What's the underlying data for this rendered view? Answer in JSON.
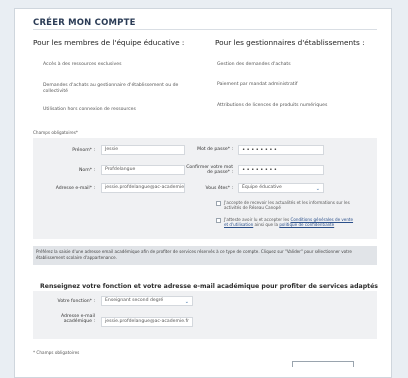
{
  "page": {
    "title": "CRÉER MON COMPTE",
    "col_left_heading": "Pour les membres de l'équipe éducative :",
    "col_right_heading": "Pour les gestionnaires d'établissements :",
    "left_features": [
      "Accès à des ressources exclusives",
      "Demandes d'achats au gestionnaire d'établissement ou de collectivité",
      "Utilisation hors connexion de ressources"
    ],
    "right_features": [
      "Gestion des demandes d'achats",
      "Paiement par mandat administratif",
      "Attributions de licences de produits numériques"
    ],
    "required_note": "Champs obligatoires*"
  },
  "form": {
    "prenom_label": "Prénom* :",
    "prenom_value": "Jessie",
    "nom_label": "Nom* :",
    "nom_value": "Profdelangue",
    "email_label": "Adresse e-mail* :",
    "email_value": "jessie.profdelangue@ac-academie.fr",
    "password_label": "Mot de passe* :",
    "password_value": "••••••••",
    "confirm_label": "Confirmer votre mot de passe* :",
    "confirm_value": "••••••••",
    "role_label": "Vous êtes* :",
    "role_value": "Équipe éducative",
    "newsletter_text": "J'accepte de recevoir les actualités et les informations sur les activités de Réseau Canopé",
    "cgv_prefix": "J'atteste avoir lu et accepter les ",
    "cgv_link": "Conditions générales de vente et d'utilisation",
    "cgv_middle": " ainsi que la ",
    "privacy_link": "politique de confidentialité"
  },
  "info": {
    "text": "Préférez la saisie d'une adresse email académique afin de profiter de services réservés à ce type de compte. Cliquez sur \"Valider\" pour sélectionner votre établissement scolaire d'appartenance."
  },
  "academic": {
    "section_title": "Renseignez votre fonction et votre adresse e-mail académique pour profiter de services adaptés",
    "function_label": "Votre fonction* :",
    "function_value": "Enseignant second degré",
    "email_label": "Adresse e-mail académique :",
    "email_value": "jessie.profdelangue@ac-academie.fr",
    "footnote": "* Champs obligatoires"
  },
  "colors": {
    "accent": "#2a3b55",
    "link": "#2a4f8a",
    "form_bg": "#f0f1f3",
    "info_bg": "#e1e4e8"
  },
  "icons": {
    "select_arrow": "chevron-down-icon"
  }
}
